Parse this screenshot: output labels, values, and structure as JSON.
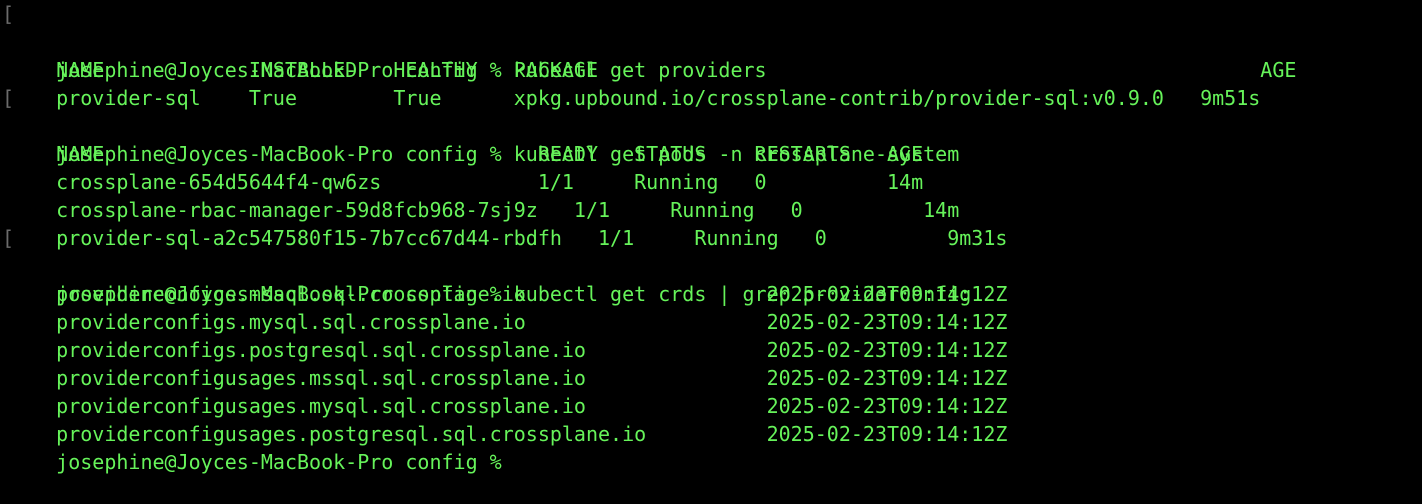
{
  "terminal": {
    "colors": {
      "background": "#000000",
      "text": "#66f35a",
      "bracket": "#6b6b6b"
    },
    "lines": [
      {
        "type": "command",
        "text": "josephine@Joyces-MacBook-Pro config % kubectl get providers"
      },
      {
        "type": "output",
        "text": "NAME            INSTALLED   HEALTHY   PACKAGE                                                       AGE"
      },
      {
        "type": "output",
        "text": "provider-sql    True        True      xpkg.upbound.io/crossplane-contrib/provider-sql:v0.9.0   9m51s"
      },
      {
        "type": "command",
        "text": "josephine@Joyces-MacBook-Pro config % kubectl get pods -n crossplane-system"
      },
      {
        "type": "output",
        "text": "NAME                                    READY   STATUS    RESTARTS   AGE"
      },
      {
        "type": "output",
        "text": "crossplane-654d5644f4-qw6zs             1/1     Running   0          14m"
      },
      {
        "type": "output",
        "text": "crossplane-rbac-manager-59d8fcb968-7sj9z   1/1     Running   0          14m"
      },
      {
        "type": "output",
        "text": "provider-sql-a2c547580f15-7b7cc67d44-rbdfh   1/1     Running   0          9m31s"
      },
      {
        "type": "command",
        "text": "josephine@Joyces-MacBook-Pro config % kubectl get crds | grep providerconfig"
      },
      {
        "type": "output",
        "text": "providerconfigs.mssql.sql.crossplane.io                    2025-02-23T09:14:12Z"
      },
      {
        "type": "output",
        "text": "providerconfigs.mysql.sql.crossplane.io                    2025-02-23T09:14:12Z"
      },
      {
        "type": "output",
        "text": "providerconfigs.postgresql.sql.crossplane.io               2025-02-23T09:14:12Z"
      },
      {
        "type": "output",
        "text": "providerconfigusages.mssql.sql.crossplane.io               2025-02-23T09:14:12Z"
      },
      {
        "type": "output",
        "text": "providerconfigusages.mysql.sql.crossplane.io               2025-02-23T09:14:12Z"
      },
      {
        "type": "output",
        "text": "providerconfigusages.postgresql.sql.crossplane.io          2025-02-23T09:14:12Z"
      },
      {
        "type": "prompt",
        "text": "josephine@Joyces-MacBook-Pro config %"
      }
    ]
  }
}
